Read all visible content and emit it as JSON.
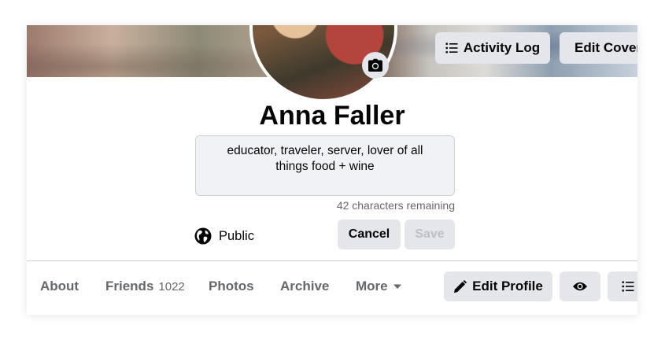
{
  "header": {
    "activity_log_label": "Activity Log",
    "edit_cover_label": "Edit Cover Photo"
  },
  "profile": {
    "name": "Anna Faller",
    "bio": "educator, traveler, server, lover of all things food + wine",
    "chars_remaining": "42 characters remaining",
    "privacy_label": "Public",
    "cancel_label": "Cancel",
    "save_label": "Save"
  },
  "nav": {
    "about": "About",
    "friends": "Friends",
    "friends_count": "1022",
    "photos": "Photos",
    "archive": "Archive",
    "more": "More",
    "edit_profile_label": "Edit Profile"
  },
  "icons": {
    "camera": "camera-icon",
    "list": "list-icon",
    "globe": "globe-icon",
    "pencil": "pencil-icon",
    "eye": "eye-icon",
    "caret": "caret-down-icon"
  },
  "colors": {
    "button_bg": "#e4e6eb",
    "text_primary": "#050505",
    "text_secondary": "#65676b",
    "disabled_text": "#bcc0c4",
    "bio_bg": "#f0f2f5"
  }
}
